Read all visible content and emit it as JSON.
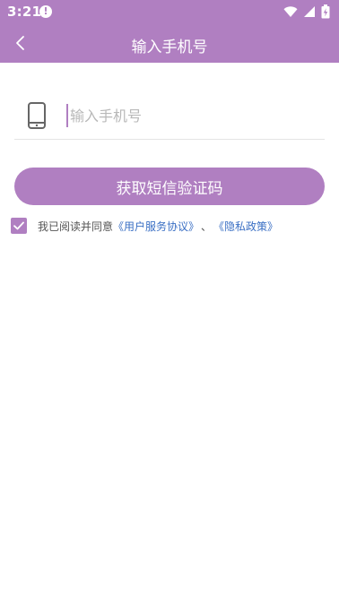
{
  "status_bar": {
    "time": "3:21",
    "alert_glyph": "!",
    "icons": [
      "wifi-icon",
      "signal-icon",
      "battery-charging-icon"
    ]
  },
  "app_bar": {
    "back_icon": "chevron-left-icon",
    "title": "输入手机号"
  },
  "phone_field": {
    "icon": "phone-icon",
    "placeholder": "输入手机号",
    "value": ""
  },
  "sms_button": {
    "label": "获取短信验证码"
  },
  "agreement": {
    "checked": true,
    "text": "我已阅读并同意",
    "user_agreement_link": "《用户服务协议》",
    "separator": "、",
    "privacy_policy_link": "《隐私政策》"
  },
  "colors": {
    "accent": "#b07fc1",
    "link": "#3a6fc4"
  }
}
